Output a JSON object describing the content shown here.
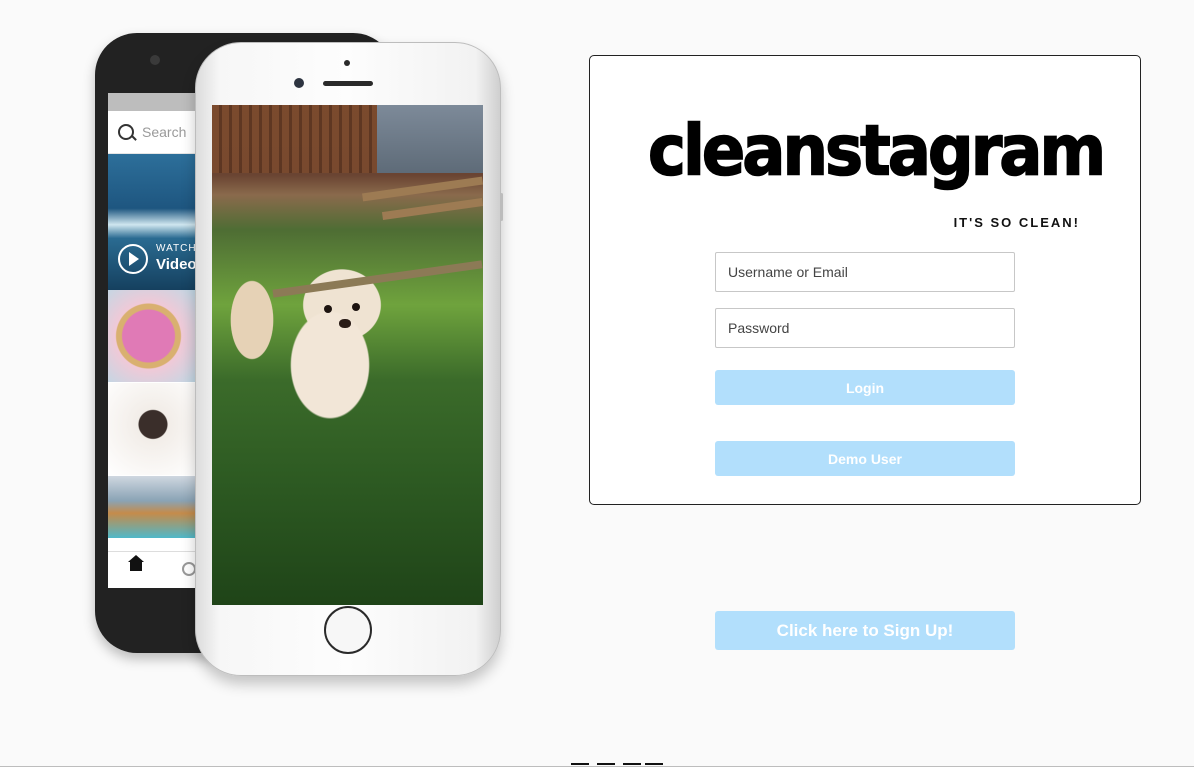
{
  "phone_back": {
    "search_placeholder": "Search",
    "watch_label": "WATCH",
    "video_label": "Video"
  },
  "login": {
    "logo_text": "cleanstagram",
    "tagline": "IT'S SO CLEAN!",
    "username_placeholder": "Username or Email",
    "password_placeholder": "Password",
    "login_button": "Login",
    "demo_button": "Demo User"
  },
  "signup": {
    "button_label": "Click here to Sign Up!"
  },
  "colors": {
    "button_bg": "#b2dffc",
    "page_bg": "#fafafa"
  }
}
